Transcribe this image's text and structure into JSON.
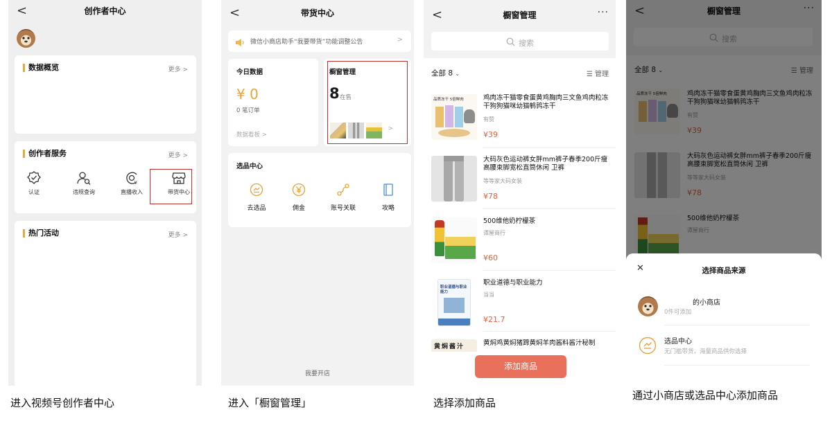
{
  "panel1": {
    "nav_back": "<",
    "title": "创作者中心",
    "data_overview": {
      "title": "数据概览",
      "more": "更多 >"
    },
    "creator_services": {
      "title": "创作者服务",
      "more": "更多 >",
      "items": [
        {
          "label": "认证",
          "icon": "verify-icon"
        },
        {
          "label": "违规查询",
          "icon": "user-search-icon"
        },
        {
          "label": "直播收入",
          "icon": "live-income-icon"
        },
        {
          "label": "带货中心",
          "icon": "store-icon"
        }
      ]
    },
    "hot_activities": {
      "title": "热门活动",
      "more": "更多 >"
    },
    "caption": "进入视频号创作者中心"
  },
  "panel2": {
    "nav_back": "<",
    "title": "带货中心",
    "notice": "微信小商店助手“我要带货”功能调整公告",
    "notice_arrow": ">",
    "today": {
      "title": "今日数据",
      "amount": "¥ 0",
      "orders": "0 笔订单",
      "board": "数据看板 >"
    },
    "showcase": {
      "title": "橱窗管理",
      "count": "8",
      "status": "在售",
      "arrow": ">"
    },
    "selection": {
      "title": "选品中心",
      "items": [
        {
          "label": "去选品",
          "icon": "select-product-icon"
        },
        {
          "label": "佣金",
          "icon": "yen-icon"
        },
        {
          "label": "账号关联",
          "icon": "link-account-icon"
        },
        {
          "label": "攻略",
          "icon": "guide-book-icon"
        }
      ]
    },
    "open_shop": "我要开店",
    "caption": "进入「橱窗管理」"
  },
  "panel3": {
    "nav_back": "<",
    "title": "橱窗管理",
    "more": "···",
    "search_placeholder": "搜索",
    "filter": "全部 8",
    "manage": "管理",
    "products": [
      {
        "title": "鸡肉冻干猫零食蛋黄鸡胸肉三文鱼鸡肉粒冻干狗狗猫咪幼猫鹌鹑冻干",
        "shop": "有赞",
        "price": "¥39",
        "thumb_label": "品质冻干 5倍鲜肉"
      },
      {
        "title": "大码灰色运动裤女胖mm裤子春季200斤瘦高腰束脚宽松直筒休闲 卫裤",
        "shop": "等等家大码女装",
        "price": "¥78"
      },
      {
        "title": "500维他奶柠檬茶",
        "shop": "谭屋商行",
        "price": "¥60"
      },
      {
        "title": "职业道德与职业能力",
        "shop": "当当",
        "price": "¥21.7",
        "thumb_label": "职业道德与职业能力"
      },
      {
        "title": "黄焖鸡黄焖猪蹄黄焖羊肉酱料酱汁秘制",
        "thumb_label": "黄焖酱汁"
      }
    ],
    "add_button": "添加商品",
    "caption": "选择添加商品"
  },
  "panel4": {
    "nav_back": "<",
    "title": "橱窗管理",
    "more": "···",
    "search_placeholder": "搜索",
    "filter": "全部 8",
    "manage": "管理",
    "products": [
      {
        "title": "鸡肉冻干猫零食蛋黄鸡胸肉三文鱼鸡肉粒冻干狗狗猫咪幼猫鹌鹑冻干",
        "shop": "有赞",
        "price": "¥39",
        "thumb_label": "品质冻干 5倍鲜肉"
      },
      {
        "title": "大码灰色运动裤女胖mm裤子春季200斤瘦高腰束脚宽松直筒休闲 卫裤",
        "shop": "等等家大码女装",
        "price": "¥78"
      },
      {
        "title": "500维他奶柠檬茶",
        "shop": "谭屋商行"
      }
    ],
    "sheet": {
      "close": "✕",
      "title": "选择商品来源",
      "options": [
        {
          "title": "的小商店",
          "sub": "0件可添加"
        },
        {
          "title": "选品中心",
          "sub": "无门槛带货，海量商品供你选择"
        }
      ]
    },
    "caption": "通过小商店或选品中心添加商品"
  },
  "colors": {
    "accent": "#f2a33a",
    "price": "#e5603b",
    "highlight": "#b5322e",
    "add_button": "#e9705a"
  }
}
